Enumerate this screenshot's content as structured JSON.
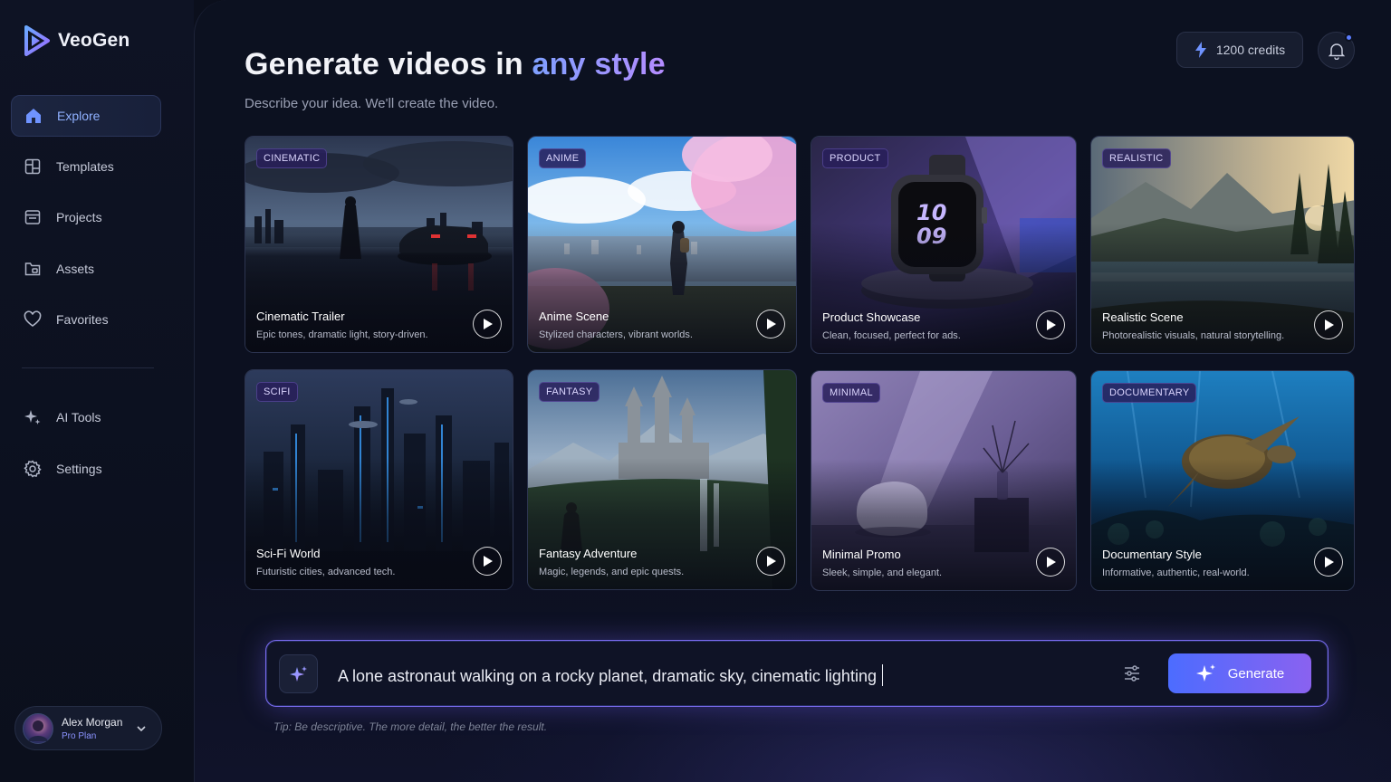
{
  "app": {
    "name": "VeoGen"
  },
  "sidebar": {
    "items": [
      {
        "label": "Explore",
        "icon": "home-icon",
        "active": true
      },
      {
        "label": "Templates",
        "icon": "templates-icon"
      },
      {
        "label": "Projects",
        "icon": "projects-icon"
      },
      {
        "label": "Assets",
        "icon": "assets-icon"
      },
      {
        "label": "Favorites",
        "icon": "heart-icon"
      }
    ],
    "tools": [
      {
        "label": "AI Tools",
        "icon": "sparkles-icon"
      },
      {
        "label": "Settings",
        "icon": "gear-icon"
      }
    ],
    "user": {
      "name": "Alex Morgan",
      "plan": "Pro Plan"
    }
  },
  "header": {
    "title_main": "Generate videos in",
    "title_accent": "any style",
    "subtitle": "Describe your idea. We'll create the video.",
    "credits": "1200 credits"
  },
  "cards": [
    {
      "badge": "CINEMATIC",
      "title": "Cinematic Trailer",
      "desc": "Epic tones, dramatic light, story-driven."
    },
    {
      "badge": "ANIME",
      "title": "Anime Scene",
      "desc": "Stylized characters, vibrant worlds."
    },
    {
      "badge": "PRODUCT",
      "title": "Product Showcase",
      "desc": "Clean, focused, perfect for ads.",
      "watch_digits": [
        "10",
        "09"
      ]
    },
    {
      "badge": "REALISTIC",
      "title": "Realistic Scene",
      "desc": "Photorealistic visuals, natural storytelling."
    },
    {
      "badge": "SCIFI",
      "title": "Sci-Fi World",
      "desc": "Futuristic cities, advanced tech."
    },
    {
      "badge": "FANTASY",
      "title": "Fantasy Adventure",
      "desc": "Magic, legends, and epic quests."
    },
    {
      "badge": "MINIMAL",
      "title": "Minimal Promo",
      "desc": "Sleek, simple, and elegant."
    },
    {
      "badge": "DOCUMENTARY",
      "title": "Documentary Style",
      "desc": "Informative, authentic, real-world."
    }
  ],
  "prompt": {
    "value": "A lone astronaut walking on a rocky planet, dramatic sky, cinematic lighting",
    "generate_label": "Generate",
    "tip": "Tip: Be descriptive. The more detail, the better the result."
  },
  "colors": {
    "accent_blue": "#7fa0ff",
    "accent_purple": "#b58cff",
    "background": "#0b0f1c",
    "notification_dot": "#5b7dff"
  }
}
